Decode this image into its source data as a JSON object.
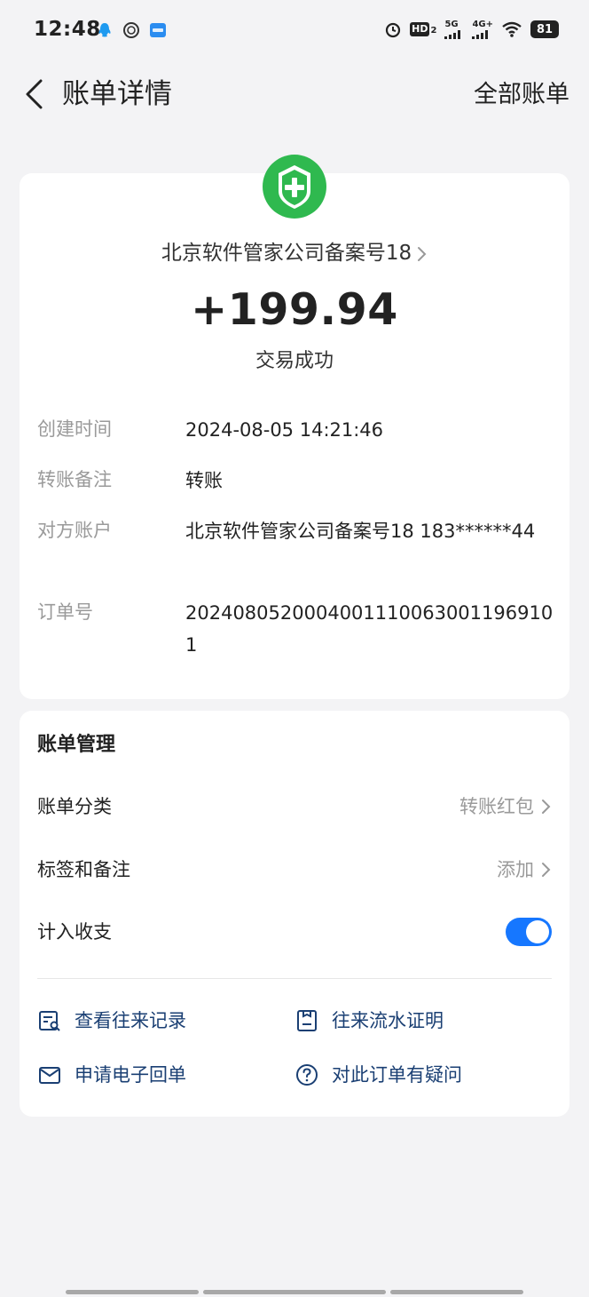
{
  "status_bar": {
    "time": "12:48",
    "left_icons": [
      "qq-icon",
      "circle-app-icon",
      "blue-app-icon"
    ],
    "hd_label": "HD",
    "hd_sub": "2",
    "network_5g": "5G",
    "network_4g": "4G+",
    "battery": "81"
  },
  "header": {
    "title": "账单详情",
    "right_link": "全部账单"
  },
  "transaction": {
    "merchant": "北京软件管家公司备案号18",
    "amount": "+199.94",
    "status": "交易成功",
    "details": [
      {
        "label": "创建时间",
        "value": "2024-08-05 14:21:46"
      },
      {
        "label": "转账备注",
        "value": "转账"
      },
      {
        "label": "对方账户",
        "value": "北京软件管家公司备案号18 183******44"
      },
      {
        "label": "订单号",
        "value": "2024080520004001110063001196910 1"
      }
    ]
  },
  "manage": {
    "title": "账单管理",
    "category_label": "账单分类",
    "category_value": "转账红包",
    "tag_label": "标签和备注",
    "tag_value": "添加",
    "include_label": "计入收支",
    "include_enabled": true,
    "actions": [
      {
        "label": "查看往来记录",
        "icon": "records-icon"
      },
      {
        "label": "往来流水证明",
        "icon": "statement-icon"
      },
      {
        "label": "申请电子回单",
        "icon": "mail-icon"
      },
      {
        "label": "对此订单有疑问",
        "icon": "question-icon"
      }
    ]
  },
  "colors": {
    "accent": "#1677ff",
    "action_text": "#1a3f73",
    "logo_green": "#2fb94f"
  }
}
